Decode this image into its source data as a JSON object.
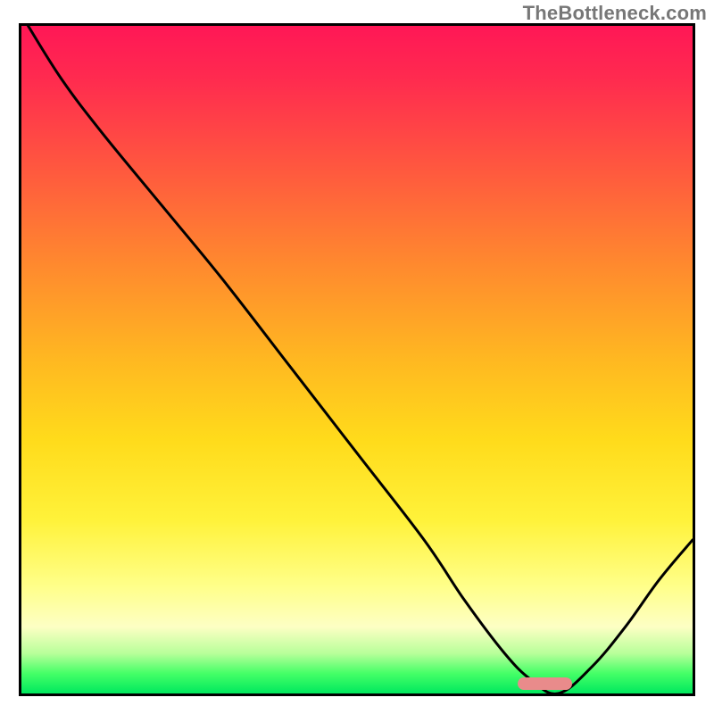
{
  "watermark": "TheBottleneck.com",
  "chart_data": {
    "type": "line",
    "title": "",
    "xlabel": "",
    "ylabel": "",
    "xlim": [
      0,
      100
    ],
    "ylim": [
      0,
      100
    ],
    "grid": false,
    "legend": false,
    "background": {
      "type": "vertical-gradient",
      "stops": [
        {
          "pos": 0,
          "color": "#ff1756"
        },
        {
          "pos": 8,
          "color": "#ff2b4f"
        },
        {
          "pos": 22,
          "color": "#ff5a3e"
        },
        {
          "pos": 36,
          "color": "#ff8a2e"
        },
        {
          "pos": 50,
          "color": "#ffb821"
        },
        {
          "pos": 62,
          "color": "#ffdb1b"
        },
        {
          "pos": 74,
          "color": "#fff23a"
        },
        {
          "pos": 84,
          "color": "#ffff8a"
        },
        {
          "pos": 90,
          "color": "#fdffc4"
        },
        {
          "pos": 94,
          "color": "#b8ff9a"
        },
        {
          "pos": 97,
          "color": "#45ff67"
        },
        {
          "pos": 100,
          "color": "#00e85e"
        }
      ]
    },
    "series": [
      {
        "name": "bottleneck-curve",
        "color": "#000000",
        "stroke_width": 3,
        "x": [
          1,
          6,
          12,
          21,
          30,
          40,
          50,
          60,
          66,
          72,
          76,
          80,
          85,
          90,
          95,
          100
        ],
        "y": [
          100,
          92,
          84,
          73,
          62,
          49,
          36,
          23,
          14,
          6,
          2,
          0,
          4,
          10,
          17,
          23
        ]
      }
    ],
    "annotations": [
      {
        "name": "optimal-marker",
        "type": "pill",
        "x_start": 74,
        "x_end": 82,
        "y": 1.5,
        "color": "#e98b8b"
      }
    ]
  }
}
